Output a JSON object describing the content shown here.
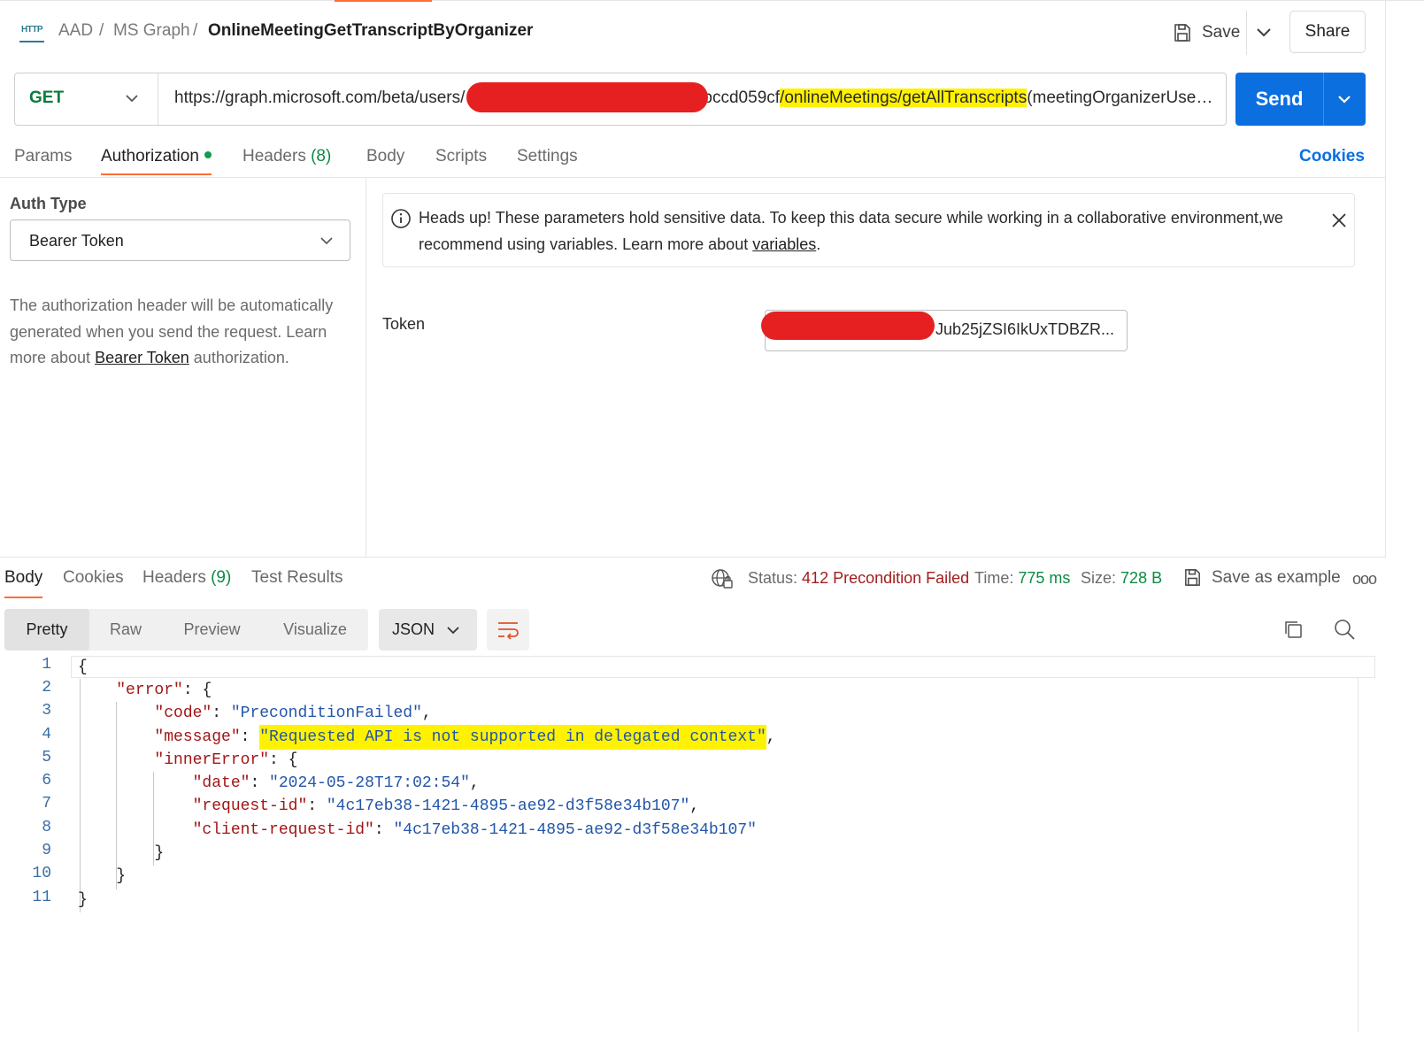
{
  "breadcrumb": {
    "icon": "http-icon",
    "items": [
      "AAD",
      "MS Graph"
    ],
    "separator": "/",
    "current": "OnlineMeetingGetTranscriptByOrganizer"
  },
  "toolbar": {
    "save_label": "Save",
    "share_label": "Share"
  },
  "request": {
    "method": "GET",
    "url_prefix": "https://graph.microsoft.com/beta/users/",
    "url_partial": "bccd059cf",
    "url_highlight": "/onlineMeetings/getAllTranscripts",
    "url_suffix": "(meetingOrganizerUse…",
    "send_label": "Send"
  },
  "request_tabs": {
    "params": "Params",
    "authorization": "Authorization",
    "headers": "Headers",
    "headers_count": "(8)",
    "body": "Body",
    "scripts": "Scripts",
    "settings": "Settings",
    "cookies": "Cookies"
  },
  "auth": {
    "type_label": "Auth Type",
    "type_value": "Bearer Token",
    "description_before": "The authorization header will be automatically generated when you send the request. Learn more about ",
    "description_link": "Bearer Token",
    "description_after": " authorization.",
    "notice_text": "Heads up! These parameters hold sensitive data. To keep this data secure while working in a collaborative environment,we recommend using variables. Learn more about ",
    "notice_link": "variables",
    "notice_end": ".",
    "token_label": "Token",
    "token_value": "Jub25jZSI6IkUxTDBZR..."
  },
  "response": {
    "tabs": {
      "body": "Body",
      "cookies": "Cookies",
      "headers": "Headers",
      "headers_count": "(9)",
      "test_results": "Test Results"
    },
    "status_label": "Status:",
    "status_value": "412 Precondition Failed",
    "time_label": "Time:",
    "time_value": "775 ms",
    "size_label": "Size:",
    "size_value": "728 B",
    "save_example": "Save as example",
    "view_modes": [
      "Pretty",
      "Raw",
      "Preview",
      "Visualize"
    ],
    "active_view": "Pretty",
    "language": "JSON",
    "colors": {
      "status_error": "#a11d1d",
      "status_ok": "#0e8a43",
      "accent": "#ff6c37",
      "send": "#0b6fe0"
    }
  },
  "body_lines": {
    "n": [
      "1",
      "2",
      "3",
      "4",
      "5",
      "6",
      "7",
      "8",
      "9",
      "10",
      "11"
    ],
    "open_brace": "{",
    "error_key": "\"error\"",
    "code_key": "\"code\"",
    "code_val": "\"PreconditionFailed\"",
    "message_key": "\"message\"",
    "message_val": "\"Requested API is not supported in delegated context\"",
    "inner_key": "\"innerError\"",
    "date_key": "\"date\"",
    "date_val": "\"2024-05-28T17:02:54\"",
    "reqid_key": "\"request-id\"",
    "reqid_val": "\"4c17eb38-1421-4895-ae92-d3f58e34b107\"",
    "creqid_key": "\"client-request-id\"",
    "creqid_val": "\"4c17eb38-1421-4895-ae92-d3f58e34b107\"",
    "close_brace": "}"
  }
}
